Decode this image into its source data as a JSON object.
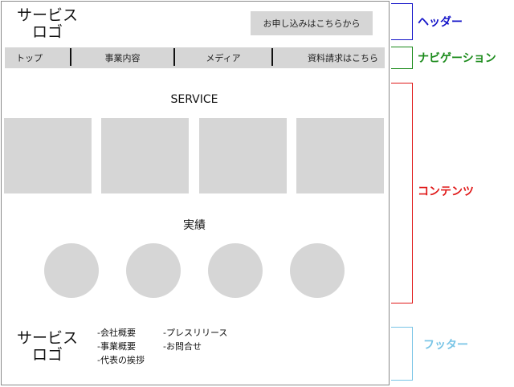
{
  "header": {
    "logo_line1": "サービス",
    "logo_line2": "ロゴ",
    "cta_label": "お申し込みはこちらから"
  },
  "nav": {
    "items": [
      {
        "label": "トップ"
      },
      {
        "label": "事業内容"
      },
      {
        "label": "メディア"
      },
      {
        "label": "資料請求はこちら"
      }
    ]
  },
  "content": {
    "service_title": "SERVICE",
    "works_title": "実績",
    "service_box_count": 4,
    "works_circle_count": 4
  },
  "footer": {
    "logo_line1": "サービス",
    "logo_line2": "ロゴ",
    "links_col1": [
      "-会社概要",
      "-事業概要",
      "-代表の挨拶"
    ],
    "links_col2": [
      "-プレスリリース",
      "-お問合せ"
    ]
  },
  "annotations": {
    "header": {
      "label": "ヘッダー",
      "color": "#1414c8"
    },
    "navigation": {
      "label": "ナビゲーション",
      "color": "#1a8a1a"
    },
    "content": {
      "label": "コンテンツ",
      "color": "#e01a1a"
    },
    "footer": {
      "label": "フッター",
      "color": "#78c4e6"
    }
  }
}
